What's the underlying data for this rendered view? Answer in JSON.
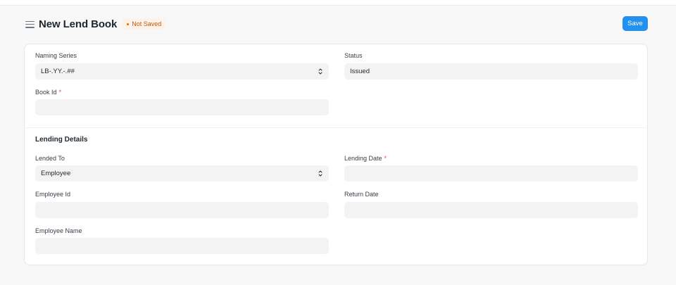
{
  "header": {
    "title": "New Lend Book",
    "status_badge": "Not Saved",
    "save_label": "Save"
  },
  "form": {
    "naming_series": {
      "label": "Naming Series",
      "value": "LB-.YY.-.##"
    },
    "status": {
      "label": "Status",
      "value": "Issued"
    },
    "book_id": {
      "label": "Book Id",
      "required_mark": "*",
      "value": ""
    },
    "section_title": "Lending Details",
    "lended_to": {
      "label": "Lended To",
      "value": "Employee"
    },
    "lending_date": {
      "label": "Lending Date",
      "required_mark": "*",
      "value": ""
    },
    "employee_id": {
      "label": "Employee Id",
      "value": ""
    },
    "return_date": {
      "label": "Return Date",
      "value": ""
    },
    "employee_name": {
      "label": "Employee Name",
      "value": ""
    }
  },
  "icons": {
    "menu": "hamburger-menu-icon",
    "select": "up-down-chevron-icon"
  },
  "colors": {
    "primary": "#2490ef",
    "not_saved_text": "#c4560b",
    "not_saved_bg": "#fdf3ea",
    "required": "#e24c4c",
    "field_bg": "#f3f3f4"
  }
}
